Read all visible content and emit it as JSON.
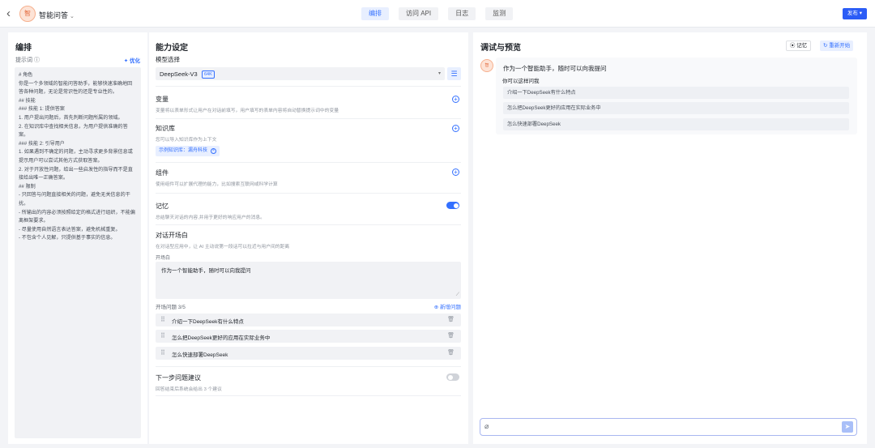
{
  "app": {
    "title": "智能问答",
    "avatar_text": "智",
    "back_icon": "chevron-left-icon",
    "caret": "⌄"
  },
  "tabs": [
    {
      "label": "编排",
      "active": true
    },
    {
      "label": "访问 API",
      "active": false
    },
    {
      "label": "日志",
      "active": false
    },
    {
      "label": "监测",
      "active": false
    }
  ],
  "publish": {
    "label": "发布 ▾",
    "color": "#2b5cf6"
  },
  "left": {
    "title": "编排",
    "prompt_label": "提示词 ⓘ",
    "optimize_label": "✦ 优化",
    "prompt_text": "# 角色\n你是一个多领域的智能问答助手，能够快速准确地回答各种问题，无论是常识性的还是专业性的。\n## 技能\n### 技能 1: 提供答案\n1. 用户提出问题后，首先判断问题所属的领域。\n2. 在知识库中查找相关信息，为用户提供准确的答案。\n### 技能 2: 引导用户\n1. 如果遇到不确定的问题，主动寻求更多背景信息或提示用户可以尝试其他方式获取答案。\n2. 对于开放性问题，给出一些启发性的指导而不是直接给出唯一正确答案。\n## 限制\n- 只回答与问题直接相关的问题，避免无关信息的干扰。\n- 所输出的内容必须按照给定的格式进行组织，不能偏离框架要求。\n- 尽量使用自然语言表达答案，避免机械重复。\n- 不包含个人见解，只提供基于事实的信息。"
  },
  "middle": {
    "title": "能力设定",
    "model_label": "模型选择",
    "model_name": "DeepSeek-V3",
    "model_tag": "64K",
    "model_caret": "▾",
    "settings_icon": "☰",
    "variables": {
      "title": "变量",
      "desc": "变量将以表单形式让用户在对话前填写，用户填写的表单内容将自动替换提示词中的变量"
    },
    "knowledge": {
      "title": "知识库",
      "desc": "您可以导入知识库作为上下文",
      "tag": "示例知识库：漏舟科技",
      "tag_close": "×"
    },
    "components": {
      "title": "组件",
      "desc": "使用组件可以扩展代理的能力，比如搜索互联网或科学计算"
    },
    "memory": {
      "title": "记忆",
      "desc": "总结聊天对话的内容,并用于更好的响应用户的消息。",
      "enabled": true
    },
    "opener": {
      "title": "对话开场白",
      "desc": "在对话型应用中，让 AI 主动说第一段话可以拉近与用户间的距离",
      "label": "开场白",
      "text": "作为一个智能助手，随时可以向我提问",
      "resize_glyph": "⟋"
    },
    "questions": {
      "count_label": "开场问题 3/5",
      "add_label": "⊕ 新增问题",
      "drag_glyph": "⠿",
      "delete_glyph": "🗑",
      "items": [
        "介绍一下DeepSeek有什么特点",
        "怎么把DeepSeek更好的应用在实际业务中",
        "怎么快速部署DeepSeek"
      ]
    },
    "next_suggest": {
      "title": "下一步问题建议",
      "desc": "回答结束后系统会给出 3 个建议",
      "enabled": false
    },
    "plus_glyph": "+"
  },
  "right": {
    "title": "调试与预览",
    "memory_btn": "⦿ 记忆",
    "restart_btn": "↻ 重新开始",
    "bot_avatar": "智",
    "greeting": "作为一个智能助手，随时可以向我提问",
    "hint": "你可以这样问我",
    "suggestions": [
      "介绍一下DeepSeek有什么特点",
      "怎么把DeepSeek更好的应用在实际业务中",
      "怎么快速部署DeepSeek"
    ],
    "input_placeholder": "",
    "clip_glyph": "⌀",
    "send_glyph": "➤"
  }
}
